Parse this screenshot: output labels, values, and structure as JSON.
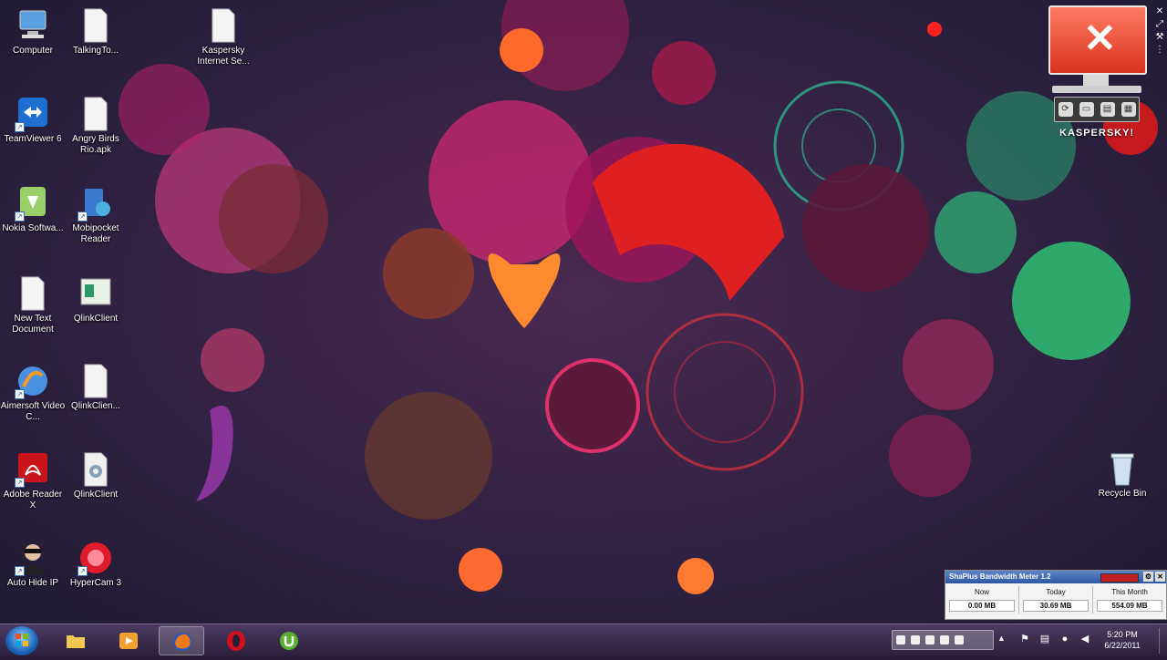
{
  "desktop_icons": [
    {
      "label": "Computer",
      "icon": "computer-icon"
    },
    {
      "label": "TalkingTo...",
      "icon": "file-icon"
    },
    {
      "label": "Kaspersky Internet Se...",
      "icon": "file-icon"
    },
    {
      "label": "TeamViewer 6",
      "icon": "teamviewer-icon"
    },
    {
      "label": "Angry Birds Rio.apk",
      "icon": "file-icon"
    },
    {
      "label": "Nokia Softwa...",
      "icon": "nokia-icon"
    },
    {
      "label": "Mobipocket Reader",
      "icon": "mobipocket-icon"
    },
    {
      "label": "New Text Document",
      "icon": "text-document-icon"
    },
    {
      "label": "QlinkClient",
      "icon": "qlink-icon"
    },
    {
      "label": "Aimersoft Video C...",
      "icon": "aimersoft-icon"
    },
    {
      "label": "QlinkClien...",
      "icon": "file-icon"
    },
    {
      "label": "Adobe Reader X",
      "icon": "adobe-reader-icon"
    },
    {
      "label": "QlinkClient",
      "icon": "settings-file-icon"
    },
    {
      "label": "Auto Hide IP",
      "icon": "auto-hide-ip-icon"
    },
    {
      "label": "HyperCam 3",
      "icon": "hypercam-icon"
    },
    {
      "label": "Recycle Bin",
      "icon": "recycle-bin-icon"
    }
  ],
  "kaspersky_gadget": {
    "brand": "KASPERSKY",
    "suffix": "!",
    "status_symbol": "✕"
  },
  "bandwidth_meter": {
    "title": "ShaPlus Bandwidth Meter 1.2",
    "columns": [
      {
        "header": "Now",
        "value": "0.00 MB"
      },
      {
        "header": "Today",
        "value": "30.69 MB"
      },
      {
        "header": "This Month",
        "value": "554.09 MB"
      }
    ]
  },
  "taskbar": {
    "pinned": [
      {
        "name": "windows-explorer",
        "icon": "folder-icon"
      },
      {
        "name": "media-player",
        "icon": "media-player-icon"
      },
      {
        "name": "firefox",
        "icon": "firefox-icon",
        "active": true
      },
      {
        "name": "opera",
        "icon": "opera-icon"
      },
      {
        "name": "utorrent",
        "icon": "utorrent-icon"
      }
    ]
  },
  "clock": {
    "time": "5:20 PM",
    "date": "6/22/2011"
  },
  "colors": {
    "kaspersky_red": "#e03b22",
    "taskbar": "#3a2b4e"
  }
}
